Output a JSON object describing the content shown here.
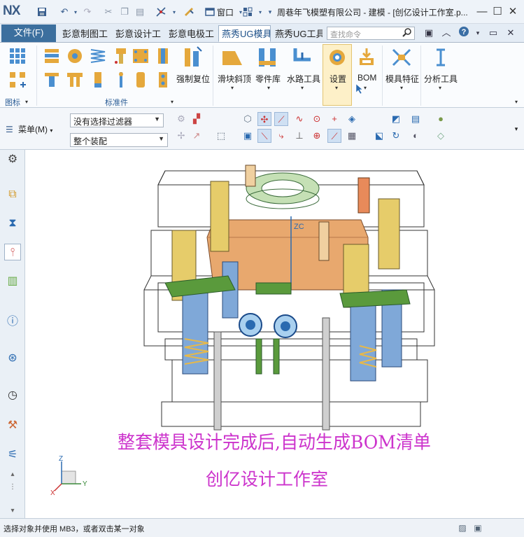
{
  "app": {
    "logo": "NX",
    "title": "周巷年飞模塑有限公司 - 建模 - [创亿设计工作室.p..."
  },
  "quick_access": {
    "window_menu": "窗口",
    "icons": [
      "save-icon",
      "undo-icon",
      "redo-icon",
      "cut-icon",
      "copy-icon",
      "paste-icon",
      "touch-mode-icon",
      "repeat-command-icon",
      "window-icon",
      "layout-icon"
    ]
  },
  "window_controls": [
    "minimize",
    "maximize",
    "close"
  ],
  "tabs": {
    "file": "文件(F)",
    "items": [
      "彭意制图工",
      "彭意设计工",
      "彭意电极工",
      "燕秀UG模具",
      "燕秀UG工具"
    ],
    "active_index": 3
  },
  "search": {
    "placeholder": "查找命令"
  },
  "ribbon": {
    "buttons": [
      {
        "label": "强制复位"
      },
      {
        "label": "滑块斜顶"
      },
      {
        "label": "零件库"
      },
      {
        "label": "水路工具"
      },
      {
        "label": "设置"
      },
      {
        "label": "BOM"
      },
      {
        "label": "模具特征"
      },
      {
        "label": "分析工具"
      }
    ],
    "groups": {
      "icons_label": "图标",
      "standard_parts_label": "标准件"
    }
  },
  "command_bar": {
    "menu_label": "菜单(M)",
    "filter_value": "没有选择过滤器",
    "scope_value": "整个装配"
  },
  "viewport": {
    "caption_line1": "整套模具设计完成后,自动生成BOM清单",
    "caption_line2": "创亿设计工作室",
    "axis_labels": {
      "z": "ZC",
      "triad_z": "Z",
      "triad_y": "Y",
      "triad_x": "X"
    },
    "model_colors": {
      "plate_orange": "#e8a86e",
      "pillar_yellow": "#e6cc6a",
      "pillar_blue": "#7fa8d8",
      "green": "#5a9a3c",
      "ring_green": "#c5e0b5",
      "wireframe": "#333333"
    }
  },
  "status": {
    "text": "选择对象并使用 MB3，或者双击某一对象"
  }
}
